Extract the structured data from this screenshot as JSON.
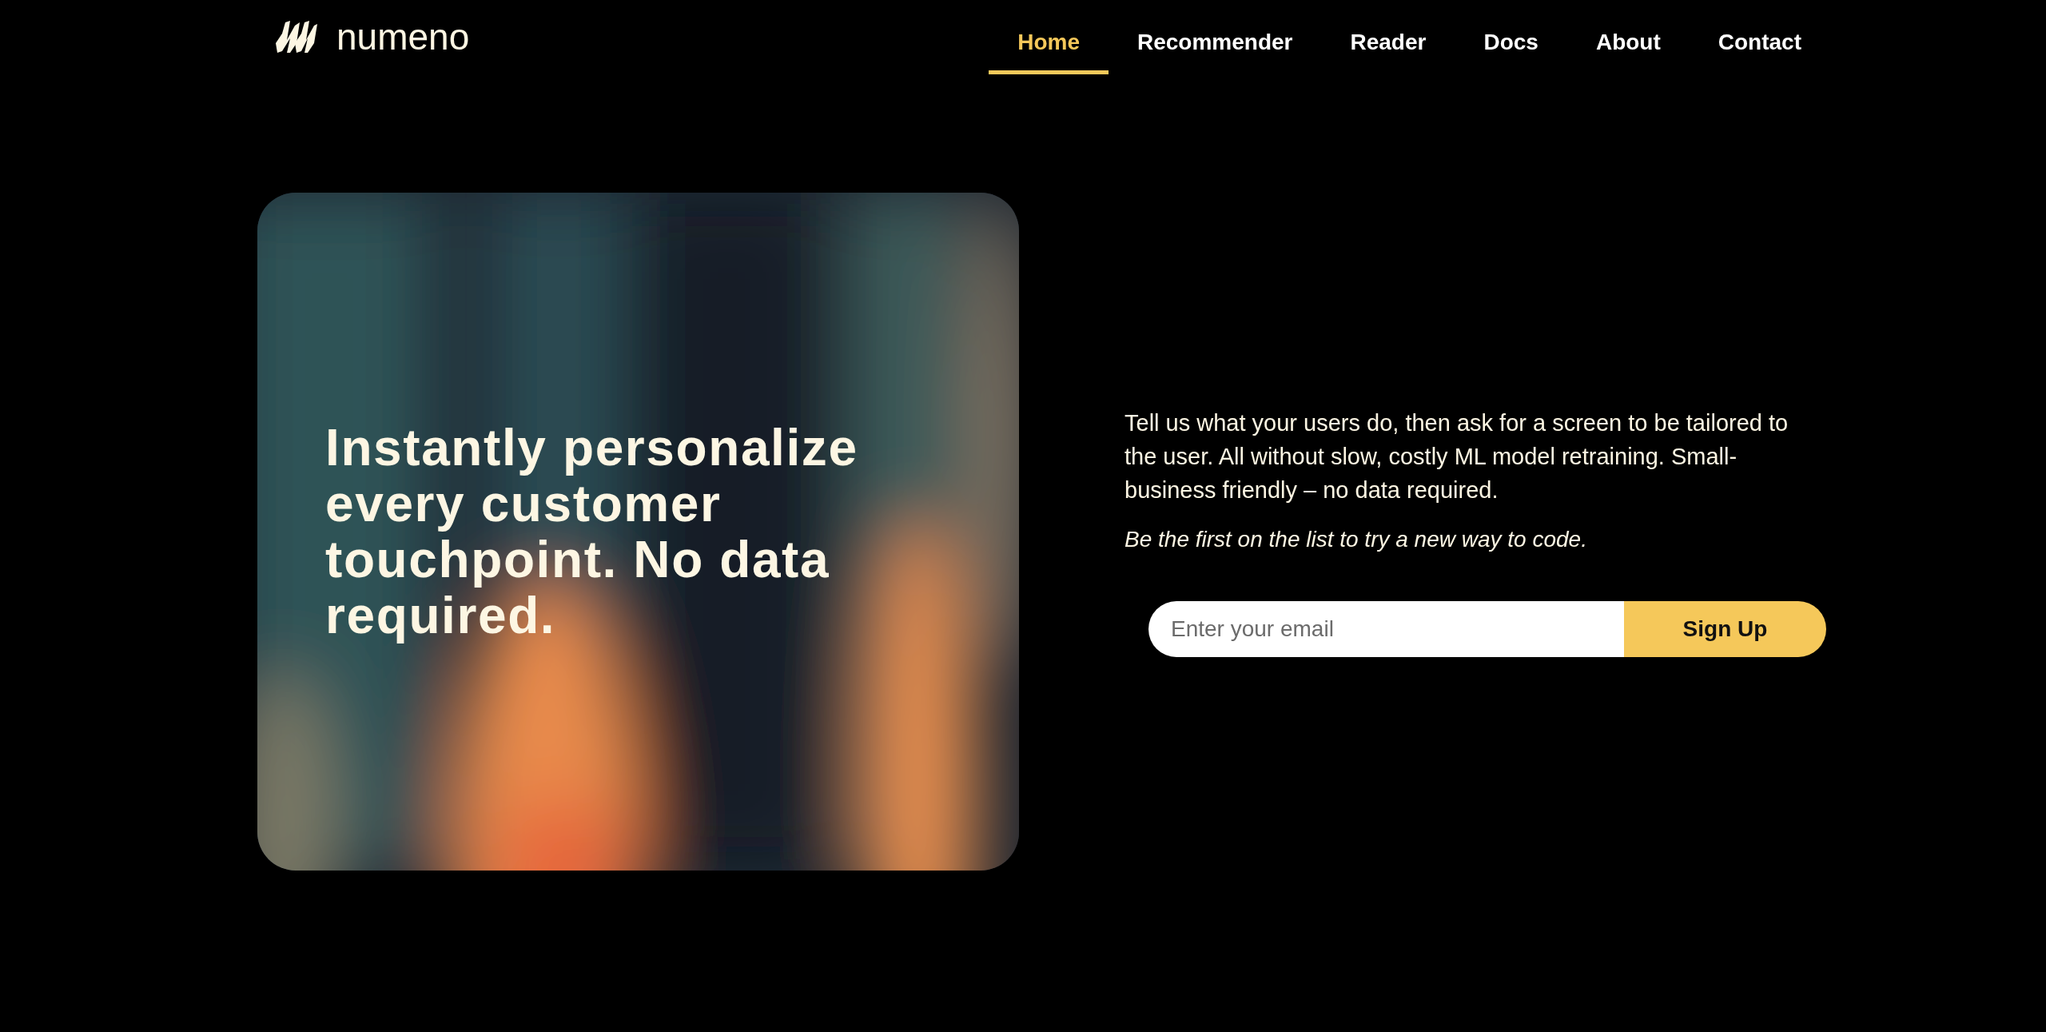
{
  "brand": {
    "name": "numeno"
  },
  "nav": [
    {
      "label": "Home",
      "selected": true
    },
    {
      "label": "Recommender",
      "selected": false
    },
    {
      "label": "Reader",
      "selected": false
    },
    {
      "label": "Docs",
      "selected": false
    },
    {
      "label": "About",
      "selected": false
    },
    {
      "label": "Contact",
      "selected": false
    }
  ],
  "hero": {
    "headline": "Instantly personalize every customer touchpoint. No data required."
  },
  "intro": {
    "description": "Tell us what your users do, then ask for a screen to be tailored to the user.  All without slow, costly ML model retraining.  Small-business friendly – no data required.",
    "tagline": "Be the first on the list to try a new way to code."
  },
  "signup": {
    "placeholder": "Enter your email",
    "button": "Sign Up"
  }
}
